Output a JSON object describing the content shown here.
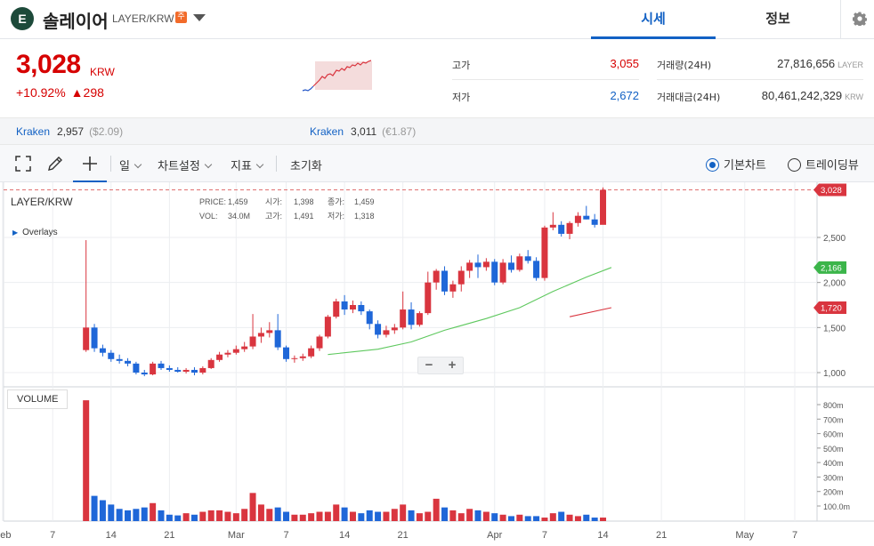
{
  "header": {
    "logo_letter": "E",
    "coin_name": "솔레이어",
    "pair": "LAYER/KRW",
    "caution_badge": "주",
    "tabs": [
      {
        "label": "시세"
      },
      {
        "label": "정보"
      }
    ]
  },
  "summary": {
    "price": "3,028",
    "unit": "KRW",
    "change_percent": "+10.92%",
    "change_amount": "▲298",
    "stats": {
      "high_label": "고가",
      "high_value": "3,055",
      "low_label": "저가",
      "low_value": "2,672",
      "volume_label": "거래량(24H)",
      "volume_value": "27,816,656",
      "volume_unit": "LAYER",
      "amount_label": "거래대금(24H)",
      "amount_value": "80,461,242,329",
      "amount_unit": "KRW"
    }
  },
  "refs": [
    {
      "exchange": "Kraken",
      "price": "2,957",
      "fiat": "($2.09)"
    },
    {
      "exchange": "Kraken",
      "price": "3,011",
      "fiat": "(€1.87)"
    }
  ],
  "toolbar": {
    "period_label": "일",
    "chart_settings_label": "차트설정",
    "indicator_label": "지표",
    "reset_label": "초기화",
    "basic_chart_label": "기본차트",
    "tradingview_label": "트레이딩뷰",
    "selected_view": "basic"
  },
  "chart_info": {
    "symbol": "LAYER/KRW",
    "overlays_label": "Overlays",
    "price_label": "PRICE:",
    "price_value": "1,459",
    "open_label": "시가:",
    "open_value": "1,398",
    "close_label": "종가:",
    "close_value": "1,459",
    "vol_label": "VOL:",
    "vol_value": "34.0M",
    "high_label": "고가:",
    "high_value": "1,491",
    "low_label": "저가:",
    "low_value": "1,318",
    "volume_title": "VOLUME",
    "zoom_out": "−",
    "zoom_in": "+"
  },
  "chart_data": {
    "type": "candlestick",
    "title": "LAYER/KRW",
    "price_axis": {
      "ticks": [
        "2,500",
        "2,000",
        "1,500",
        "1,000"
      ],
      "tick_values": [
        2500,
        2000,
        1500,
        1000
      ],
      "range": [
        800,
        3000
      ]
    },
    "volume_axis": {
      "ticks": [
        "800m",
        "700m",
        "600m",
        "500m",
        "400m",
        "300m",
        "200m",
        "100.0m"
      ],
      "tick_values": [
        800,
        700,
        600,
        500,
        400,
        300,
        200,
        100
      ],
      "range": [
        0,
        830
      ]
    },
    "x_axis": {
      "labels": [
        "Feb",
        "7",
        "14",
        "21",
        "Mar",
        "7",
        "14",
        "21",
        "Apr",
        "7",
        "14",
        "21",
        "May",
        "7"
      ],
      "label_dates": [
        "2025-02-01",
        "2025-02-07",
        "2025-02-14",
        "2025-02-21",
        "2025-03-01",
        "2025-03-07",
        "2025-03-14",
        "2025-03-21",
        "2025-04-01",
        "2025-04-07",
        "2025-04-14",
        "2025-04-21",
        "2025-05-01",
        "2025-05-07"
      ]
    },
    "price_tags": [
      {
        "value": "3,028",
        "color": "#d9353f"
      },
      {
        "value": "2,166",
        "color": "#3bb54a"
      },
      {
        "value": "1,720",
        "color": "#d9353f"
      }
    ],
    "up_color": "#d9353f",
    "down_color": "#1f67d8",
    "candles": [
      {
        "date": "2025-02-11",
        "o": 1250,
        "h": 2470,
        "l": 1230,
        "c": 1500
      },
      {
        "date": "2025-02-12",
        "o": 1500,
        "h": 1540,
        "l": 1230,
        "c": 1270
      },
      {
        "date": "2025-02-13",
        "o": 1270,
        "h": 1310,
        "l": 1180,
        "c": 1220
      },
      {
        "date": "2025-02-14",
        "o": 1220,
        "h": 1250,
        "l": 1120,
        "c": 1150
      },
      {
        "date": "2025-02-15",
        "o": 1150,
        "h": 1200,
        "l": 1100,
        "c": 1130
      },
      {
        "date": "2025-02-16",
        "o": 1130,
        "h": 1160,
        "l": 1070,
        "c": 1100
      },
      {
        "date": "2025-02-17",
        "o": 1100,
        "h": 1120,
        "l": 980,
        "c": 1000
      },
      {
        "date": "2025-02-18",
        "o": 1000,
        "h": 1030,
        "l": 960,
        "c": 980
      },
      {
        "date": "2025-02-19",
        "o": 980,
        "h": 1120,
        "l": 970,
        "c": 1100
      },
      {
        "date": "2025-02-20",
        "o": 1100,
        "h": 1130,
        "l": 1030,
        "c": 1050
      },
      {
        "date": "2025-02-21",
        "o": 1050,
        "h": 1080,
        "l": 1010,
        "c": 1030
      },
      {
        "date": "2025-02-22",
        "o": 1030,
        "h": 1060,
        "l": 1000,
        "c": 1010
      },
      {
        "date": "2025-02-23",
        "o": 1010,
        "h": 1050,
        "l": 990,
        "c": 1030
      },
      {
        "date": "2025-02-24",
        "o": 1030,
        "h": 1060,
        "l": 970,
        "c": 1000
      },
      {
        "date": "2025-02-25",
        "o": 1000,
        "h": 1070,
        "l": 980,
        "c": 1050
      },
      {
        "date": "2025-02-26",
        "o": 1050,
        "h": 1160,
        "l": 1040,
        "c": 1140
      },
      {
        "date": "2025-02-27",
        "o": 1140,
        "h": 1230,
        "l": 1120,
        "c": 1200
      },
      {
        "date": "2025-02-28",
        "o": 1200,
        "h": 1250,
        "l": 1170,
        "c": 1220
      },
      {
        "date": "2025-03-01",
        "o": 1220,
        "h": 1300,
        "l": 1200,
        "c": 1260
      },
      {
        "date": "2025-03-02",
        "o": 1260,
        "h": 1340,
        "l": 1230,
        "c": 1290
      },
      {
        "date": "2025-03-03",
        "o": 1290,
        "h": 1650,
        "l": 1260,
        "c": 1400
      },
      {
        "date": "2025-03-04",
        "o": 1400,
        "h": 1500,
        "l": 1330,
        "c": 1440
      },
      {
        "date": "2025-03-05",
        "o": 1440,
        "h": 1560,
        "l": 1390,
        "c": 1470
      },
      {
        "date": "2025-03-06",
        "o": 1470,
        "h": 1650,
        "l": 1250,
        "c": 1280
      },
      {
        "date": "2025-03-07",
        "o": 1280,
        "h": 1300,
        "l": 1120,
        "c": 1150
      },
      {
        "date": "2025-03-08",
        "o": 1150,
        "h": 1190,
        "l": 1110,
        "c": 1160
      },
      {
        "date": "2025-03-09",
        "o": 1160,
        "h": 1210,
        "l": 1130,
        "c": 1180
      },
      {
        "date": "2025-03-10",
        "o": 1180,
        "h": 1300,
        "l": 1160,
        "c": 1270
      },
      {
        "date": "2025-03-11",
        "o": 1270,
        "h": 1420,
        "l": 1240,
        "c": 1400
      },
      {
        "date": "2025-03-12",
        "o": 1400,
        "h": 1640,
        "l": 1380,
        "c": 1620
      },
      {
        "date": "2025-03-13",
        "o": 1620,
        "h": 1820,
        "l": 1600,
        "c": 1790
      },
      {
        "date": "2025-03-14",
        "o": 1790,
        "h": 1860,
        "l": 1640,
        "c": 1700
      },
      {
        "date": "2025-03-15",
        "o": 1700,
        "h": 1800,
        "l": 1660,
        "c": 1750
      },
      {
        "date": "2025-03-16",
        "o": 1750,
        "h": 1790,
        "l": 1640,
        "c": 1680
      },
      {
        "date": "2025-03-17",
        "o": 1680,
        "h": 1700,
        "l": 1480,
        "c": 1540
      },
      {
        "date": "2025-03-18",
        "o": 1540,
        "h": 1580,
        "l": 1380,
        "c": 1420
      },
      {
        "date": "2025-03-19",
        "o": 1420,
        "h": 1520,
        "l": 1390,
        "c": 1470
      },
      {
        "date": "2025-03-20",
        "o": 1470,
        "h": 1540,
        "l": 1430,
        "c": 1500
      },
      {
        "date": "2025-03-21",
        "o": 1500,
        "h": 1900,
        "l": 1480,
        "c": 1700
      },
      {
        "date": "2025-03-22",
        "o": 1700,
        "h": 1780,
        "l": 1480,
        "c": 1530
      },
      {
        "date": "2025-03-23",
        "o": 1530,
        "h": 1680,
        "l": 1510,
        "c": 1660
      },
      {
        "date": "2025-03-24",
        "o": 1660,
        "h": 2120,
        "l": 1640,
        "c": 2000
      },
      {
        "date": "2025-03-25",
        "o": 2000,
        "h": 2150,
        "l": 1920,
        "c": 2130
      },
      {
        "date": "2025-03-26",
        "o": 2130,
        "h": 2180,
        "l": 1860,
        "c": 1900
      },
      {
        "date": "2025-03-27",
        "o": 1900,
        "h": 2020,
        "l": 1830,
        "c": 1980
      },
      {
        "date": "2025-03-28",
        "o": 1980,
        "h": 2180,
        "l": 1900,
        "c": 2130
      },
      {
        "date": "2025-03-29",
        "o": 2130,
        "h": 2250,
        "l": 2050,
        "c": 2220
      },
      {
        "date": "2025-03-30",
        "o": 2220,
        "h": 2310,
        "l": 2050,
        "c": 2170
      },
      {
        "date": "2025-03-31",
        "o": 2170,
        "h": 2270,
        "l": 2130,
        "c": 2230
      },
      {
        "date": "2025-04-01",
        "o": 2230,
        "h": 2260,
        "l": 1970,
        "c": 2000
      },
      {
        "date": "2025-04-02",
        "o": 2000,
        "h": 2260,
        "l": 1980,
        "c": 2220
      },
      {
        "date": "2025-04-03",
        "o": 2220,
        "h": 2300,
        "l": 2110,
        "c": 2140
      },
      {
        "date": "2025-04-04",
        "o": 2140,
        "h": 2320,
        "l": 2120,
        "c": 2290
      },
      {
        "date": "2025-04-05",
        "o": 2290,
        "h": 2360,
        "l": 2210,
        "c": 2240
      },
      {
        "date": "2025-04-06",
        "o": 2240,
        "h": 2280,
        "l": 2020,
        "c": 2050
      },
      {
        "date": "2025-04-07",
        "o": 2050,
        "h": 2630,
        "l": 2020,
        "c": 2610
      },
      {
        "date": "2025-04-08",
        "o": 2610,
        "h": 2780,
        "l": 2580,
        "c": 2640
      },
      {
        "date": "2025-04-09",
        "o": 2640,
        "h": 2680,
        "l": 2510,
        "c": 2540
      },
      {
        "date": "2025-04-10",
        "o": 2540,
        "h": 2680,
        "l": 2480,
        "c": 2660
      },
      {
        "date": "2025-04-11",
        "o": 2660,
        "h": 2780,
        "l": 2620,
        "c": 2740
      },
      {
        "date": "2025-04-12",
        "o": 2740,
        "h": 2850,
        "l": 2700,
        "c": 2700
      },
      {
        "date": "2025-04-13",
        "o": 2700,
        "h": 2760,
        "l": 2610,
        "c": 2640
      },
      {
        "date": "2025-04-14",
        "o": 2640,
        "h": 3055,
        "l": 2672,
        "c": 3028
      }
    ],
    "moving_averages": [
      {
        "color": "#5ec85e",
        "points": [
          [
            "2025-03-12",
            1200
          ],
          [
            "2025-03-18",
            1260
          ],
          [
            "2025-03-22",
            1340
          ],
          [
            "2025-03-26",
            1470
          ],
          [
            "2025-03-31",
            1600
          ],
          [
            "2025-04-04",
            1720
          ],
          [
            "2025-04-08",
            1900
          ],
          [
            "2025-04-12",
            2060
          ],
          [
            "2025-04-15",
            2166
          ]
        ]
      },
      {
        "color": "#d9353f",
        "points": [
          [
            "2025-04-10",
            1620
          ],
          [
            "2025-04-15",
            1720
          ]
        ]
      }
    ],
    "volume": [
      830,
      170,
      140,
      110,
      80,
      70,
      80,
      90,
      120,
      70,
      40,
      35,
      50,
      40,
      60,
      70,
      70,
      60,
      50,
      80,
      190,
      110,
      80,
      90,
      60,
      40,
      40,
      50,
      60,
      60,
      110,
      90,
      60,
      50,
      70,
      60,
      60,
      80,
      110,
      70,
      50,
      60,
      150,
      90,
      70,
      50,
      80,
      70,
      60,
      50,
      40,
      30,
      40,
      30,
      30,
      20,
      50,
      60,
      40,
      30,
      40,
      20,
      20,
      25
    ]
  }
}
